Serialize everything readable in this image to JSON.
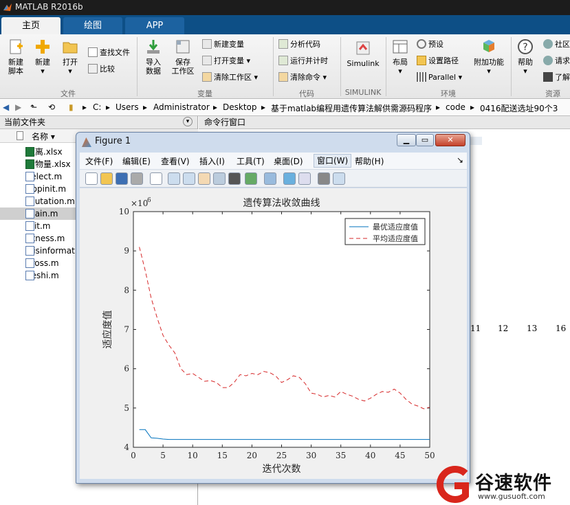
{
  "window": {
    "title": "MATLAB R2016b"
  },
  "tabs": [
    {
      "label": "主页"
    },
    {
      "label": "绘图"
    },
    {
      "label": "APP"
    }
  ],
  "ribbon": {
    "file": {
      "new_script": "新建\n脚本",
      "new": "新建",
      "open": "打开",
      "find_files": "查找文件",
      "compare": "比较",
      "section": "文件"
    },
    "variable": {
      "import": "导入\n数据",
      "save_ws": "保存\n工作区",
      "new_var": "新建变量",
      "open_var": "打开变量",
      "clear_ws": "清除工作区",
      "section": "变量"
    },
    "code": {
      "analyze": "分析代码",
      "run_time": "运行并计时",
      "clear_cmd": "清除命令",
      "section": "代码"
    },
    "simulink": {
      "label": "Simulink",
      "section": "SIMULINK"
    },
    "env": {
      "layout": "布局",
      "prefs": "预设",
      "set_path": "设置路径",
      "parallel": "Parallel",
      "addons": "附加功能",
      "section": "环境"
    },
    "res": {
      "help": "帮助",
      "community": "社区",
      "request": "请求",
      "learn": "了解",
      "section": "资源"
    }
  },
  "address": {
    "crumbs": [
      "C:",
      "Users",
      "Administrator",
      "Desktop",
      "基于matlab编程用遗传算法解供需源码程序",
      "code",
      "0416配送选址90个3"
    ]
  },
  "file_panel": {
    "title": "当前文件夹",
    "col_name": "名称 ▾",
    "files": [
      {
        "name": "距离.xlsx",
        "type": "xlsx"
      },
      {
        "name": "货物量.xlsx",
        "type": "xlsx"
      },
      {
        "name": "select.m",
        "type": "m"
      },
      {
        "name": "popinit.m",
        "type": "m"
      },
      {
        "name": "mutation.m",
        "type": "m"
      },
      {
        "name": "main.m",
        "type": "m",
        "selected": true
      },
      {
        "name": "init.m",
        "type": "m"
      },
      {
        "name": "fitness.m",
        "type": "m"
      },
      {
        "name": "Disinformat",
        "type": "m"
      },
      {
        "name": "cross.m",
        "type": "m"
      },
      {
        "name": "ceshi.m",
        "type": "m"
      }
    ]
  },
  "command_panel": {
    "title": "命令行窗口",
    "numbers": [
      "11",
      "12",
      "13",
      "16"
    ]
  },
  "figure": {
    "title": "Figure 1",
    "menu": [
      "文件(F)",
      "编辑(E)",
      "查看(V)",
      "插入(I)",
      "工具(T)",
      "桌面(D)",
      "窗口(W)",
      "帮助(H)"
    ],
    "tools": [
      "new-icon",
      "open-icon",
      "save-icon",
      "print-icon",
      "pointer-icon",
      "zoom-in-icon",
      "zoom-out-icon",
      "pan-icon",
      "rotate-icon",
      "datacursor-icon",
      "brush-icon",
      "link-icon",
      "colorbar-icon",
      "legend-icon",
      "hide-plot-tools-icon",
      "show-plot-tools-icon"
    ]
  },
  "chart_data": {
    "type": "line",
    "title": "遗传算法收敛曲线",
    "xlabel": "迭代次数",
    "ylabel": "适应度值",
    "exponent_label": "×10",
    "exponent_power": "6",
    "xlim": [
      0,
      50
    ],
    "ylim": [
      4,
      10
    ],
    "xticks": [
      "0",
      "5",
      "10",
      "15",
      "20",
      "25",
      "30",
      "35",
      "40",
      "45",
      "50"
    ],
    "yticks": [
      "4",
      "5",
      "6",
      "7",
      "8",
      "9",
      "10"
    ],
    "legend": {
      "position": "top-right",
      "entries": [
        "最优适应度值",
        "平均适应度值"
      ]
    },
    "series": [
      {
        "name": "最优适应度值",
        "color": "#0072bd",
        "style": "solid",
        "x": [
          1,
          2,
          3,
          4,
          5,
          6,
          8,
          10,
          15,
          20,
          30,
          40,
          50
        ],
        "y": [
          4.45,
          4.45,
          4.24,
          4.23,
          4.21,
          4.2,
          4.2,
          4.2,
          4.2,
          4.2,
          4.2,
          4.2,
          4.2
        ]
      },
      {
        "name": "平均适应度值",
        "color": "#d62728",
        "style": "dashed",
        "x": [
          1,
          2,
          3,
          4,
          5,
          6,
          7,
          8,
          9,
          10,
          11,
          12,
          13,
          14,
          15,
          16,
          17,
          18,
          19,
          20,
          21,
          22,
          23,
          24,
          25,
          26,
          27,
          28,
          29,
          30,
          31,
          32,
          33,
          34,
          35,
          36,
          37,
          38,
          39,
          40,
          41,
          42,
          43,
          44,
          45,
          46,
          47,
          48,
          49,
          50
        ],
        "y": [
          9.1,
          8.5,
          7.8,
          7.3,
          6.85,
          6.6,
          6.4,
          6.0,
          5.85,
          5.88,
          5.78,
          5.68,
          5.7,
          5.65,
          5.52,
          5.52,
          5.65,
          5.85,
          5.82,
          5.88,
          5.85,
          5.93,
          5.9,
          5.82,
          5.65,
          5.72,
          5.82,
          5.78,
          5.62,
          5.38,
          5.35,
          5.28,
          5.32,
          5.28,
          5.42,
          5.35,
          5.3,
          5.22,
          5.18,
          5.25,
          5.35,
          5.42,
          5.4,
          5.48,
          5.38,
          5.22,
          5.1,
          5.05,
          4.98,
          5.02
        ]
      }
    ]
  },
  "watermark": {
    "brand": "谷速软件",
    "url": "www.gusuoft.com"
  }
}
